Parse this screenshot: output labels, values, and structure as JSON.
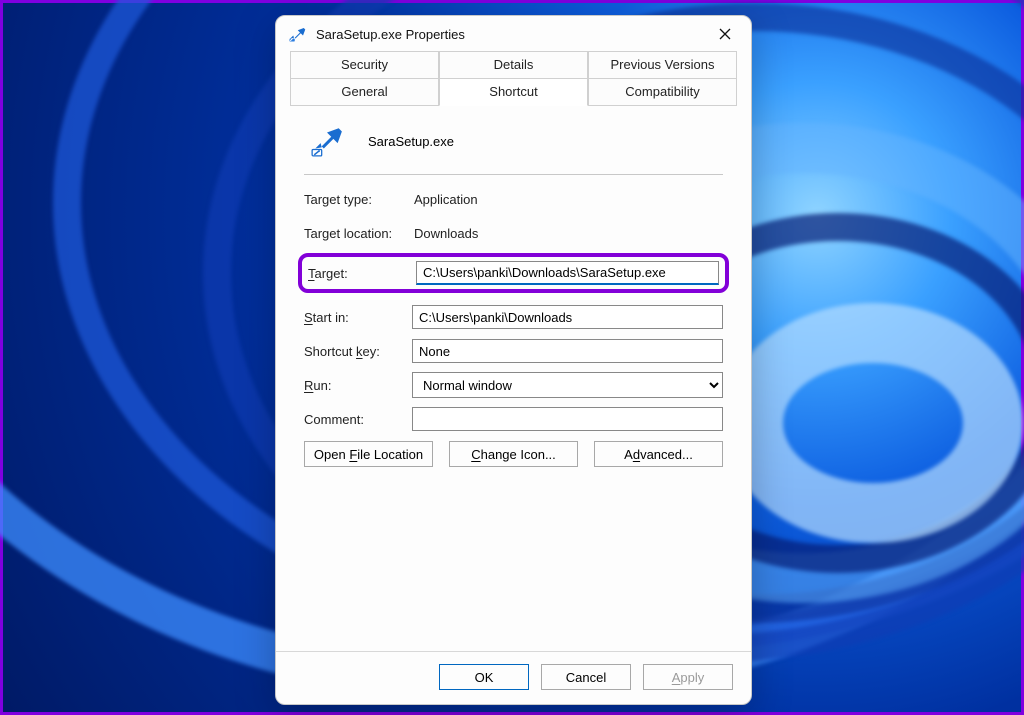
{
  "window": {
    "title": "SaraSetup.exe Properties",
    "filename": "SaraSetup.exe"
  },
  "tabs": {
    "security": "Security",
    "details": "Details",
    "previous_versions": "Previous Versions",
    "general": "General",
    "shortcut": "Shortcut",
    "compatibility": "Compatibility"
  },
  "labels": {
    "target_type": "Target type:",
    "target_location": "Target location:",
    "target": "Target:",
    "start_in": "Start in:",
    "shortcut_key": "Shortcut key:",
    "run": "Run:",
    "comment": "Comment:"
  },
  "fields": {
    "target_type": "Application",
    "target_location": "Downloads",
    "target": "C:\\Users\\panki\\Downloads\\SaraSetup.exe",
    "start_in": "C:\\Users\\panki\\Downloads",
    "shortcut_key": "None",
    "run": "Normal window",
    "comment": ""
  },
  "buttons": {
    "open_file_location": "Open File Location",
    "change_icon": "Change Icon...",
    "advanced": "Advanced...",
    "ok": "OK",
    "cancel": "Cancel",
    "apply": "Apply"
  },
  "accesskeys": {
    "target": "T",
    "start_in": "S",
    "shortcut_key": "k",
    "run": "R",
    "open_file_location": "F",
    "change_icon": "C",
    "advanced": "d",
    "apply": "A"
  }
}
